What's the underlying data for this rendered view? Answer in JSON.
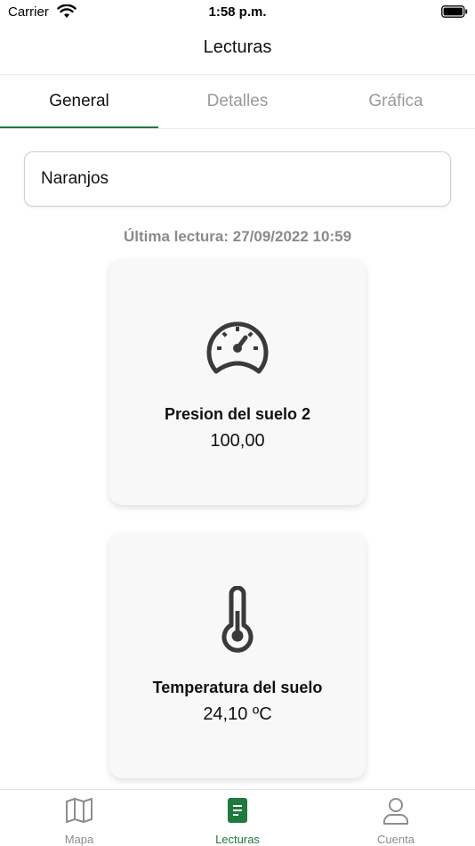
{
  "status_bar": {
    "carrier": "Carrier",
    "time": "1:58 p.m."
  },
  "nav": {
    "title": "Lecturas"
  },
  "tabs": [
    {
      "label": "General",
      "active": true
    },
    {
      "label": "Detalles",
      "active": false
    },
    {
      "label": "Gráfica",
      "active": false
    }
  ],
  "selector": {
    "value": "Naranjos"
  },
  "last_reading": "Última lectura: 27/09/2022 10:59",
  "cards": [
    {
      "icon": "gauge-icon",
      "title": "Presion del suelo 2",
      "value": "100,00"
    },
    {
      "icon": "thermometer-icon",
      "title": "Temperatura del suelo",
      "value": "24,10 ºC"
    }
  ],
  "tabbar": [
    {
      "icon": "map-icon",
      "label": "Mapa",
      "active": false
    },
    {
      "icon": "document-icon",
      "label": "Lecturas",
      "active": true
    },
    {
      "icon": "person-icon",
      "label": "Cuenta",
      "active": false
    }
  ],
  "colors": {
    "accent": "#1f7a3d",
    "inactive": "#9a9a9a"
  }
}
